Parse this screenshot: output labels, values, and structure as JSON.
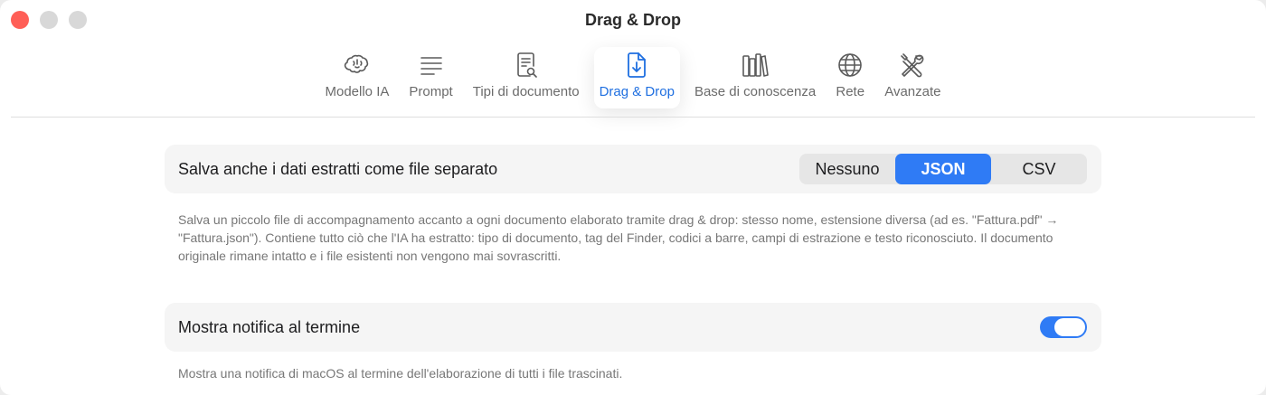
{
  "window": {
    "title": "Drag & Drop"
  },
  "toolbar": {
    "tabs": [
      {
        "id": "modello",
        "label": "Modello IA",
        "icon": "brain-icon"
      },
      {
        "id": "prompt",
        "label": "Prompt",
        "icon": "text-lines-icon"
      },
      {
        "id": "tipi",
        "label": "Tipi di documento",
        "icon": "document-search-icon"
      },
      {
        "id": "dragdrop",
        "label": "Drag & Drop",
        "icon": "document-download-icon",
        "active": true
      },
      {
        "id": "base",
        "label": "Base di conoscenza",
        "icon": "books-icon"
      },
      {
        "id": "rete",
        "label": "Rete",
        "icon": "globe-icon"
      },
      {
        "id": "avanzate",
        "label": "Avanzate",
        "icon": "tools-icon"
      }
    ]
  },
  "settings": {
    "save_extracted": {
      "label": "Salva anche i dati estratti come file separato",
      "options": [
        "Nessuno",
        "JSON",
        "CSV"
      ],
      "selected": "JSON",
      "description": "Salva un piccolo file di accompagnamento accanto a ogni documento elaborato tramite drag & drop: stesso nome, estensione diversa (ad es. \"Fattura.pdf\" → \"Fattura.json\"). Contiene tutto ciò che l'IA ha estratto: tipo di documento, tag del Finder, codici a barre, campi di estrazione e testo riconosciuto. Il documento originale rimane intatto e i file esistenti non vengono mai sovrascritti."
    },
    "notify": {
      "label": "Mostra notifica al termine",
      "enabled": true,
      "description": "Mostra una notifica di macOS al termine dell'elaborazione di tutti i file trascinati."
    }
  },
  "colors": {
    "accent": "#2f7bf5",
    "close": "#ff5f57"
  }
}
